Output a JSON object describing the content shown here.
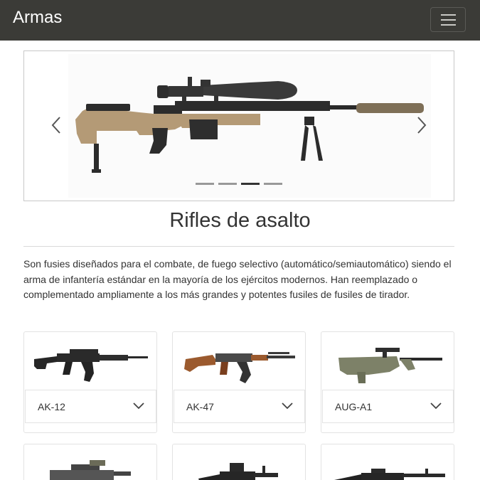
{
  "navbar": {
    "brand": "Armas",
    "menu_icon": "hamburger-icon"
  },
  "carousel": {
    "prev_icon": "chevron-left-icon",
    "next_icon": "chevron-right-icon",
    "indicator_count": 4,
    "active_index": 2
  },
  "section": {
    "title": "Rifles de asalto",
    "description": "Son fusies diseñados para el combate, de fuego selectivo (automático/semiautomático) siendo el arma de infantería estándar en la mayoría de los ejércitos modernos. Han reemplazado o complementado ampliamente a los más grandes y potentes fusiles de fusiles de tirador."
  },
  "cards": [
    {
      "name": "AK-12"
    },
    {
      "name": "AK-47"
    },
    {
      "name": "AUG-A1"
    }
  ],
  "colors": {
    "navbar": "#3b3b37",
    "rifle_tan": "#b49a76",
    "wood": "#9b5a2e",
    "olive": "#7d8168"
  }
}
